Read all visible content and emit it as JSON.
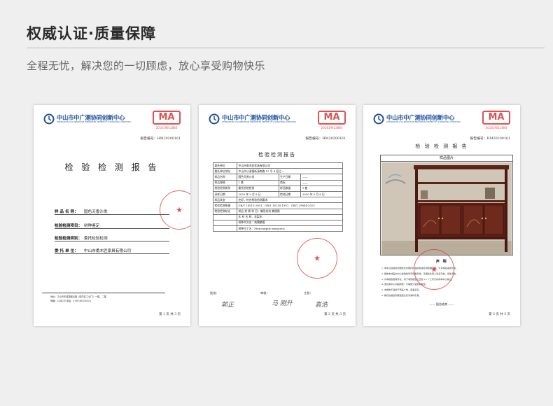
{
  "header": {
    "title": "权威认证·质量保障",
    "subtitle": "全程无忧，解决您的一切顾虑，放心享受购物快乐"
  },
  "documents": [
    {
      "org_name": "中山市中广测协同创新中心",
      "org_sub": "ZHONGSHAN COLLABORATIVE INNOVATION CENTER OF GUANGDONG SURVEYING",
      "ma_mark": "MA",
      "ma_number": "2018190128​84",
      "report_no": "报告编号：HM20200161",
      "title": "检 验 检 测 报 告",
      "fields": [
        {
          "label": "样 品 名 称：",
          "value": "国色天香沙发"
        },
        {
          "label": "检验检测项目：",
          "value": "树种鉴定"
        },
        {
          "label": "检验检测类别：",
          "value": "委托检验检测"
        },
        {
          "label": "委 托 单 位：",
          "value": "中山市甬木匠家具有限公司"
        }
      ],
      "footer_lines": [
        "地址：中山市东城镇城北路（鹤竹区工业门）一楼、二楼",
        "邮编：528476          电话：0760-86305026"
      ],
      "page": "第 1 页 共 3 页"
    },
    {
      "org_name": "中山市中广测协同创新中心",
      "org_sub": "ZHONGSHAN COLLABORATIVE INNOVATION CENTER OF GUANGDONG SURVEYING",
      "ma_mark": "MA",
      "ma_number": "2018190128​84",
      "report_no": "报告编号：HM20200161",
      "title": "检验检测报告",
      "table": [
        [
          "委托单位",
          "中山市甬木匠家具有限公司",
          "",
          ""
        ],
        [
          "委托单位地址",
          "中山市沙溪镇新濠南路 12 号 4 层之一",
          "",
          ""
        ],
        [
          "样品名称",
          "国色天香沙发",
          "生产日期",
          "——"
        ],
        [
          "样品规格",
          "1 套",
          "商标",
          "——"
        ],
        [
          "检验检测类别",
          "委托检验检测",
          "样品数量",
          "1 套"
        ],
        [
          "采样日期",
          "2020 年 5 月 6 日",
          "检测日期",
          "2020 年 5 月 8 日"
        ],
        [
          "样品状态",
          "完好，符合检验检测要求",
          "",
          ""
        ],
        [
          "检验检测依据",
          "GB/T 18513-2001、GB/T 16734-1997、GB/T 29894-2013",
          "",
          ""
        ],
        [
          "检验检测结论",
          "样品 类 属 科 目：蝶形花科 紫檀属",
          "",
          ""
        ],
        [
          "",
          "木 材 名 称：花梨木",
          "",
          ""
        ],
        [
          "",
          "树种中文名：刺猬紫檀",
          "",
          ""
        ],
        [
          "",
          "树种拉丁名：Pterocarpus erinaceus",
          "",
          ""
        ]
      ],
      "sign_labels": [
        "批准：",
        "审核：",
        "主检："
      ],
      "signatures": [
        "郭正",
        "马 刚升",
        "袁浩"
      ],
      "page": "第 2 页 共 3 页"
    },
    {
      "org_name": "中山市中广测协同创新中心",
      "org_sub": "ZHONGSHAN COLLABORATIVE INNOVATION CENTER OF GUANGDONG SURVEYING",
      "ma_mark": "MA",
      "ma_number": "2018190128​84",
      "report_no": "报告编号：HM20200161",
      "title": "检 验 检 测 报 告",
      "photo_label": "样品图片",
      "declaration_title": "声  明",
      "declarations": [
        "1. 本中心检验检测报告仅对委托样品的检验检测结果负责，不对样品来源负责。",
        "2. 报告未加盖本中心检验检测专用章无效，无相关负责人签名无效，涂改无效。",
        "3. 对本报告若有异议，请于收到报告之日起 15 个工作日内向本中心提出。",
        "4. 未经本中心书面同意，不得部分复制本报告。",
        "5. 本报告不得用于商品广告，违者必究。",
        "6. 委托检验检测报告结论仅对来样负责。"
      ],
      "end_text": "—— 报告结束 ——",
      "page": "第 3 页 共 3 页"
    }
  ],
  "colors": {
    "org_blue": "#1f4f9a",
    "stamp_red": "#e05252",
    "background": "#efefef"
  }
}
